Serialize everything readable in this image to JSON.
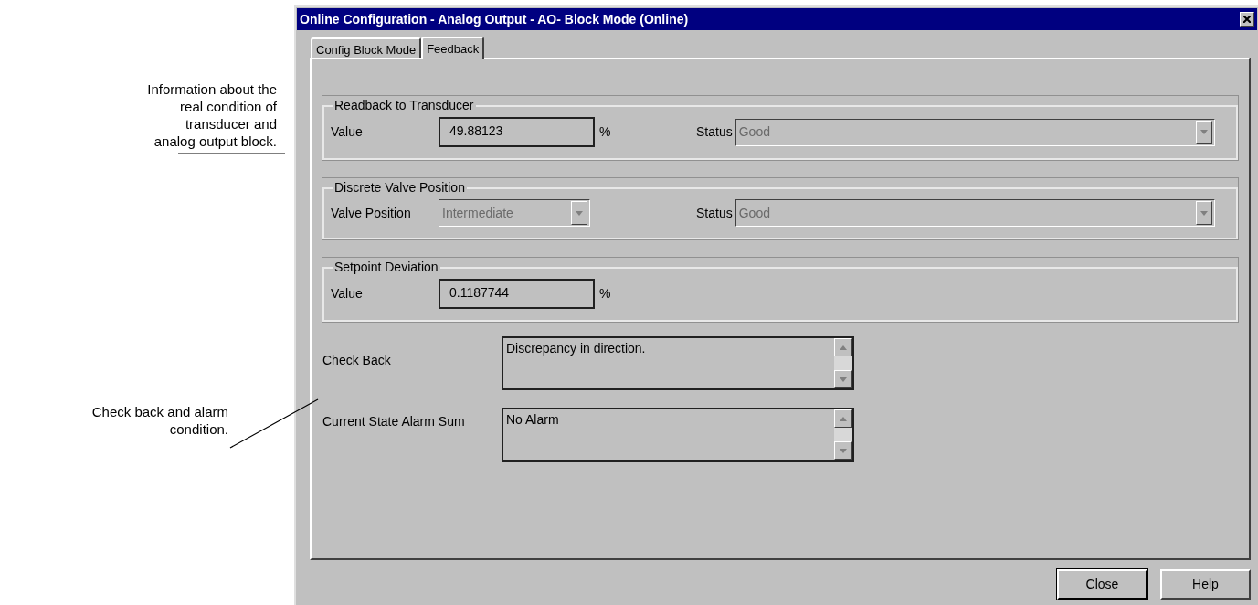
{
  "annotations": [
    {
      "text": "Information about the real condition of transducer and analog output block."
    },
    {
      "text": "Check back and alarm condition."
    }
  ],
  "window": {
    "title": "Online Configuration - Analog Output - AO- Block Mode  (Online)"
  },
  "tabs": [
    {
      "label": "Config Block Mode",
      "selected": false
    },
    {
      "label": "Feedback",
      "selected": true
    }
  ],
  "groups": [
    {
      "title": "Readback to Transducer",
      "fields": [
        {
          "kind": "text",
          "label": "Value",
          "value": "49.88123",
          "unit": "%"
        },
        {
          "kind": "dropdown",
          "label": "Status",
          "value": "Good",
          "disabled": true
        }
      ]
    },
    {
      "title": "Discrete Valve Position",
      "fields": [
        {
          "kind": "dropdown",
          "label": "Valve Position",
          "value": "Intermediate",
          "disabled": true
        },
        {
          "kind": "dropdown",
          "label": "Status",
          "value": "Good",
          "disabled": true
        }
      ]
    },
    {
      "title": "Setpoint Deviation",
      "fields": [
        {
          "kind": "text",
          "label": "Value",
          "value": "0.1187744",
          "unit": "%"
        }
      ]
    }
  ],
  "text_areas": [
    {
      "label": "Check Back",
      "value": "Discrepancy in direction."
    },
    {
      "label": "Current State Alarm Sum",
      "value": "No Alarm"
    }
  ],
  "buttons": [
    {
      "label": "Close",
      "default": true
    },
    {
      "label": "Help",
      "default": false
    }
  ]
}
